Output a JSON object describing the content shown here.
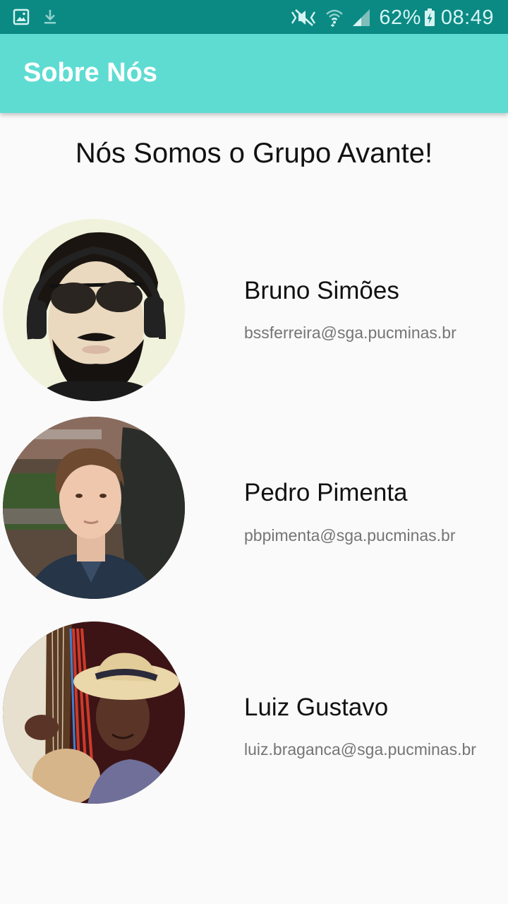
{
  "status_bar": {
    "icons": [
      "gallery-icon",
      "download-icon",
      "mute-icon",
      "wifi-icon",
      "signal-icon",
      "battery-charging-icon"
    ],
    "battery": "62%",
    "time": "08:49"
  },
  "app_bar": {
    "title": "Sobre Nós"
  },
  "main": {
    "heading": "Nós Somos o Grupo Avante!",
    "members": [
      {
        "name": "Bruno Simões",
        "email": "bssferreira@sga.pucminas.br"
      },
      {
        "name": "Pedro Pimenta",
        "email": "pbpimenta@sga.pucminas.br"
      },
      {
        "name": "Luiz Gustavo",
        "email": "luiz.braganca@sga.pucminas.br"
      }
    ]
  },
  "colors": {
    "status_bar": "#0b8a84",
    "app_bar": "#5edcd2",
    "background": "#fafafa",
    "email_text": "#757575"
  }
}
